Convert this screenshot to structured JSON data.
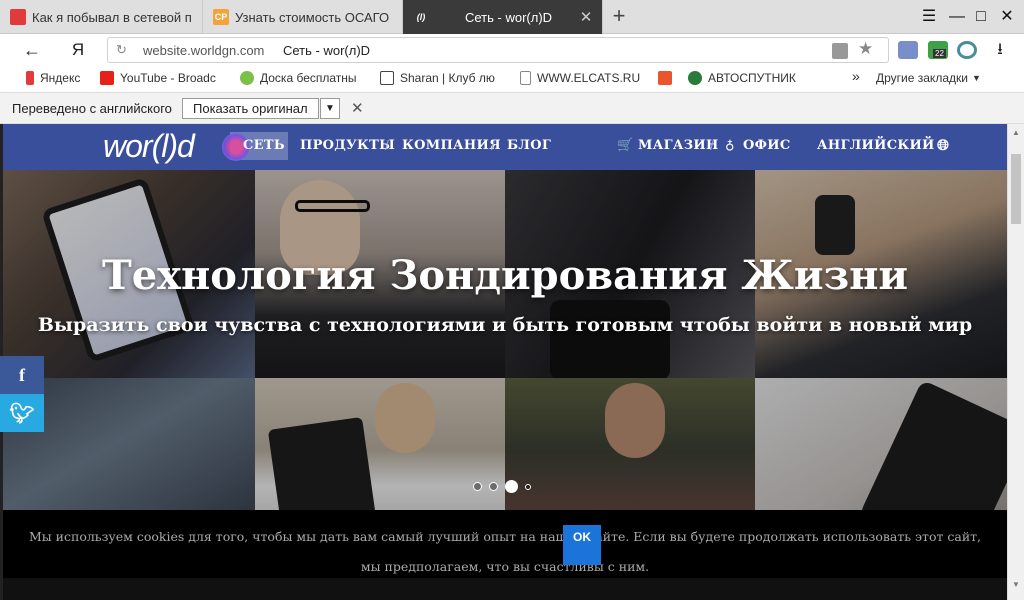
{
  "tabs": [
    {
      "title": "Как я побывал в сетевой п",
      "favicon_color": "#e23a3a",
      "favicon_text": "▀"
    },
    {
      "title": "Узнать стоимость ОСАГО",
      "favicon_color": "#f2a43a",
      "favicon_text": "CP"
    },
    {
      "title": "Сеть - wor(л)D",
      "favicon_color": "#3a3a3a",
      "favicon_text": "(l)",
      "active": true
    }
  ],
  "toolbar": {
    "url_host": "website.worldgn.com",
    "page_title": "Сеть - wor(л)D",
    "browser_logo": "Я",
    "badge_count": "22"
  },
  "bookmarks": [
    {
      "label": "Яндекс",
      "color": "#e23a3a"
    },
    {
      "label": "YouTube - Broadc",
      "color": "#e62117"
    },
    {
      "label": "Доска бесплатны",
      "color": "#7cc04a"
    },
    {
      "label": "Sharan | Клуб лю",
      "color": "#444"
    },
    {
      "label": "WWW.ELCATS.RU",
      "color": "#bbb"
    },
    {
      "label": "",
      "color": "#e8542c"
    },
    {
      "label": "АВТОСПУТНИК",
      "color": "#2a7a3a"
    }
  ],
  "bookmarks_more": "Другие закладки",
  "translate_bar": {
    "label": "Переведено с английского",
    "show_original": "Показать оригинал"
  },
  "site": {
    "logo": "wor(l)d",
    "nav": [
      "СЕТЬ",
      "ПРОДУКТЫ",
      "КОМПАНИЯ",
      "БЛОГ"
    ],
    "nav_right": [
      "МАГАЗИН",
      "ОФИС",
      "АНГЛИЙСКИЙ"
    ],
    "brand_color": "#3a4f9c"
  },
  "hero": {
    "title": "Технология Зондирования Жизни",
    "subtitle": "Выразить свои чувства с технологиями и быть готовым чтобы войти в новый мир",
    "slide_count": 4,
    "active_slide": 3
  },
  "social": [
    {
      "icon": "facebook-icon",
      "glyph": "f",
      "color": "#3b5998"
    },
    {
      "icon": "twitter-icon",
      "glyph": "t",
      "color": "#29a9e1"
    }
  ],
  "cookie": {
    "text": "Мы используем cookies для того, чтобы мы дать вам самый лучший опыт на нашем сайте. Если вы будете продолжать использовать этот сайт, мы предполагаем, что вы счастливы с ним.",
    "ok_label": "OK"
  }
}
